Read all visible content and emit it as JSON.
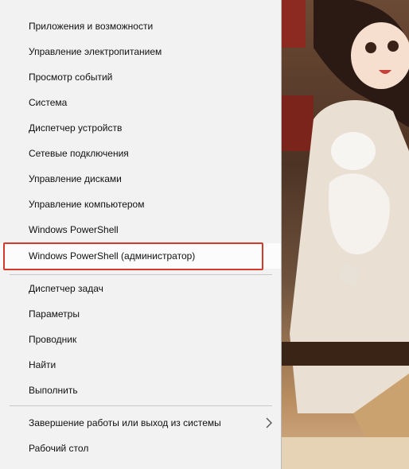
{
  "menu": {
    "items": [
      {
        "label": "Приложения и возможности"
      },
      {
        "label": "Управление электропитанием"
      },
      {
        "label": "Просмотр событий"
      },
      {
        "label": "Система"
      },
      {
        "label": "Диспетчер устройств"
      },
      {
        "label": "Сетевые подключения"
      },
      {
        "label": "Управление дисками"
      },
      {
        "label": "Управление компьютером"
      },
      {
        "label": "Windows PowerShell"
      },
      {
        "label": "Windows PowerShell (администратор)"
      },
      {
        "label": "Диспетчер задач"
      },
      {
        "label": "Параметры"
      },
      {
        "label": "Проводник"
      },
      {
        "label": "Найти"
      },
      {
        "label": "Выполнить"
      },
      {
        "label": "Завершение работы или выход из системы"
      },
      {
        "label": "Рабочий стол"
      }
    ],
    "submenu_icon": "chevron-right-icon",
    "highlight_color": "#d33a2c"
  }
}
